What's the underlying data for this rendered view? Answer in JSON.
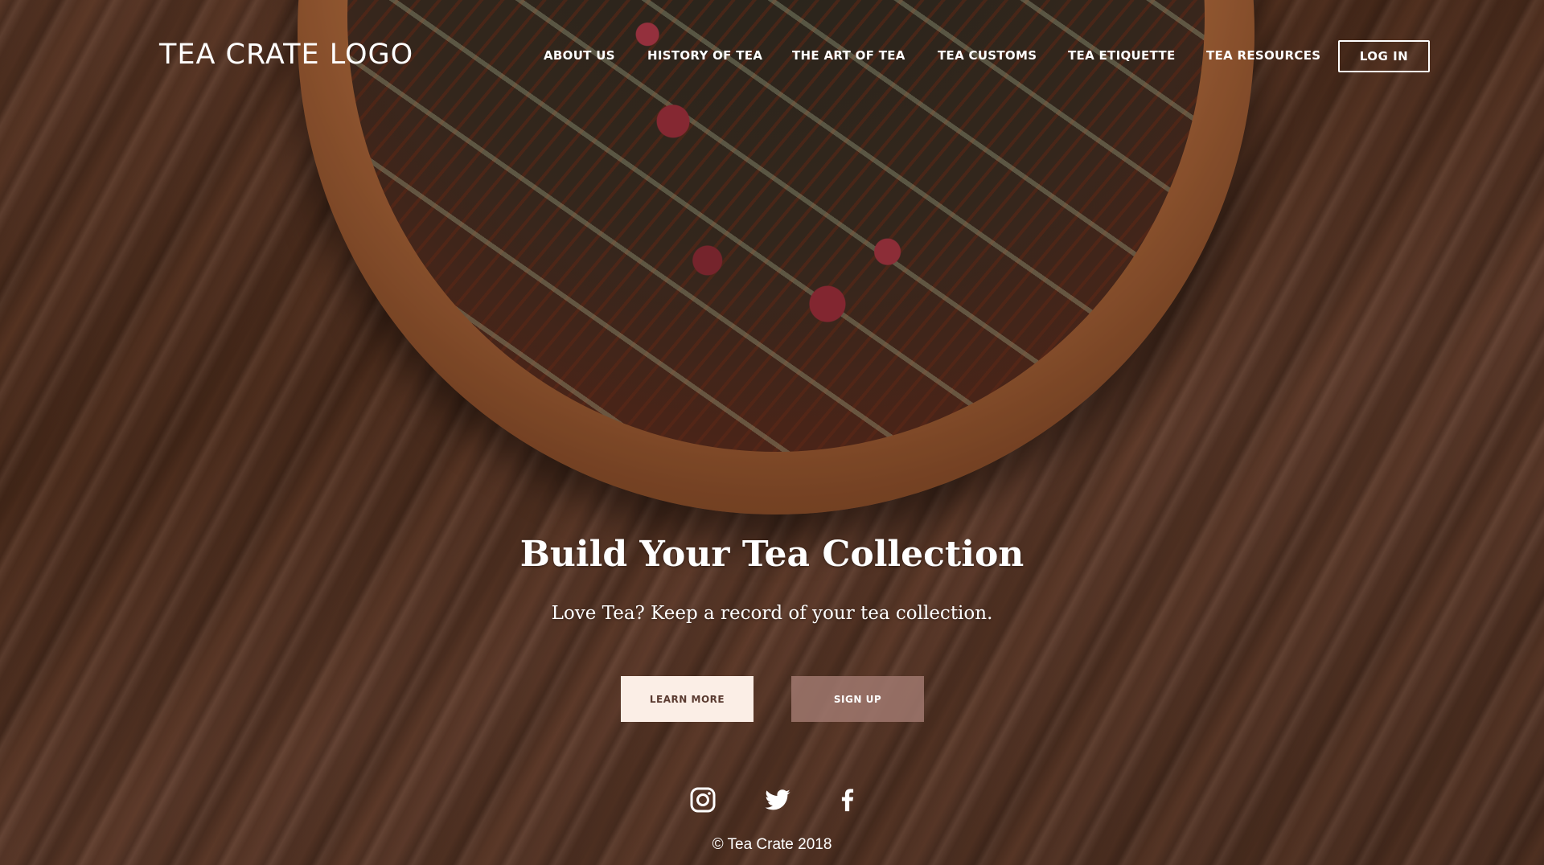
{
  "header": {
    "logo": "TEA CRATE LOGO",
    "nav": [
      {
        "label": "ABOUT US"
      },
      {
        "label": "HISTORY OF TEA"
      },
      {
        "label": "THE ART OF TEA"
      },
      {
        "label": "TEA CUSTOMS"
      },
      {
        "label": "TEA ETIQUETTE"
      },
      {
        "label": "TEA RESOURCES"
      }
    ],
    "login_label": "LOG IN"
  },
  "hero": {
    "title": "Build Your Tea Collection",
    "subtitle": "Love Tea? Keep a record of your tea collection.",
    "learn_more_label": "LEARN MORE",
    "sign_up_label": "SIGN UP"
  },
  "social": {
    "icons": [
      "instagram-icon",
      "twitter-icon",
      "facebook-icon"
    ]
  },
  "footer": {
    "copyright": "© Tea Crate 2018"
  },
  "colors": {
    "text": "#ffffff",
    "learn_more_bg": "#fbeee6",
    "learn_more_text": "#5a3a30",
    "sign_up_bg": "#a0786e"
  }
}
